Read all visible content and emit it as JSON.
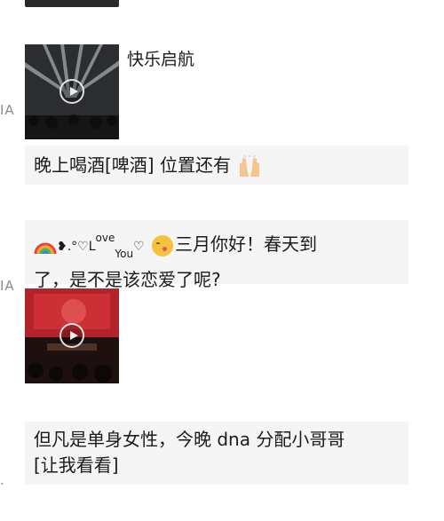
{
  "edge_labels": {
    "first": "IA",
    "second": "IA",
    "third": "."
  },
  "messages": [
    {
      "type": "video",
      "caption": "快乐启航"
    },
    {
      "type": "text",
      "text": "晚上喝酒[啤酒]  位置还有"
    },
    {
      "type": "text",
      "line1_a": "❥.°♡L",
      "line1_b": "ove",
      "line1_c": "You",
      "line1_d": "♡",
      "line1_e": "三月你好！春天到",
      "line2": "了，是不是该恋爱了呢?"
    },
    {
      "type": "video"
    },
    {
      "type": "text",
      "line1": "但凡是单身女性，今晚 dna 分配小哥哥",
      "line2": "[让我看看]"
    }
  ]
}
